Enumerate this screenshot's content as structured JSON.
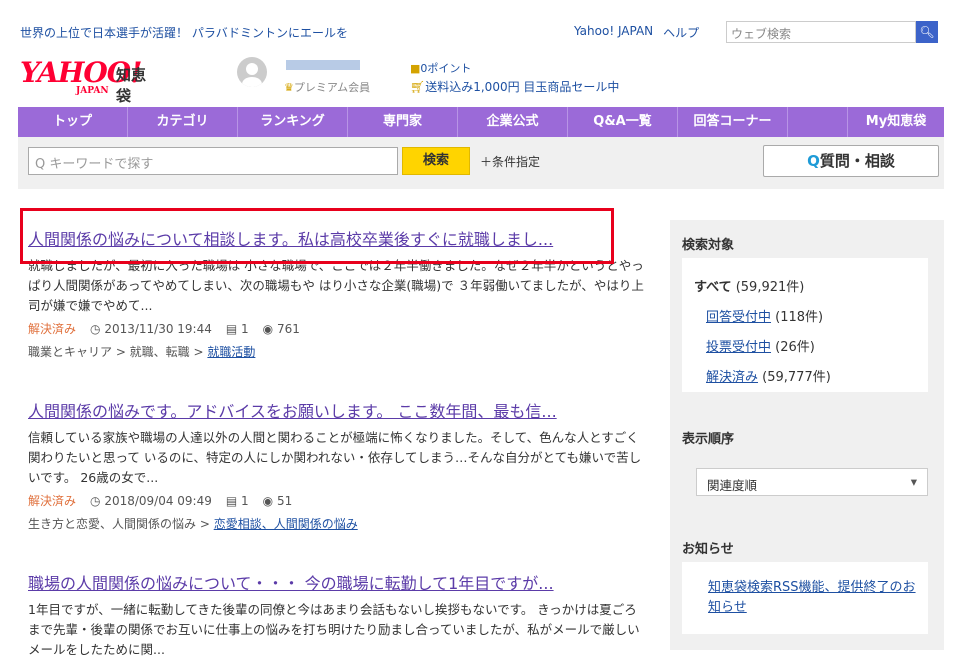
{
  "header": {
    "promo": "世界の上位で日本選手が活躍！ パラバドミントンにエールを",
    "links": [
      "Yahoo! JAPAN",
      "ヘルプ"
    ],
    "web_search_placeholder": "ウェブ検索",
    "logo_text": "YAHOO!",
    "logo_sub": "JAPAN",
    "logo_service": "知恵袋",
    "premium": "プレミアム会員",
    "points": "0ポイント",
    "sale": "送料込み1,000円 目玉商品セール中"
  },
  "nav": {
    "items": [
      "トップ",
      "カテゴリ",
      "ランキング",
      "専門家",
      "企業公式",
      "Q&A一覧",
      "回答コーナー",
      "",
      "My知恵袋"
    ]
  },
  "search": {
    "placeholder": "キーワードで探す",
    "button": "検索",
    "conditions": "条件指定",
    "ask_button": "質問・相談"
  },
  "results": [
    {
      "title": "人間関係の悩みについて相談します。私は高校卒業後すぐに就職しまし...",
      "body": "就職しましたが、最初に入った職場は 小さな職場で、ここでは２年半働きました。なぜ２年半かというとやっぱり人間関係があってやめてしまい、次の職場もや はり小さな企業(職場)で ３年弱働いてましたが、やはり上司が嫌で嫌でやめて...",
      "status": "解決済み",
      "date": "2013/11/30 19:44",
      "answers": "1",
      "views": "761",
      "category_path": "職業とキャリア > 就職、転職 > ",
      "category_link": "就職活動"
    },
    {
      "title": "人間関係の悩みです。アドバイスをお願いします。 ここ数年間、最も信...",
      "body": "信頼している家族や職場の人達以外の人間と関わることが極端に怖くなりました。そして、色んな人とすごく関わりたいと思って いるのに、特定の人にしか関われない・依存してしまう…そんな自分がとても嫌いで苦しいです。 26歳の女で...",
      "status": "解決済み",
      "date": "2018/09/04 09:49",
      "answers": "1",
      "views": "51",
      "category_path": "生き方と恋愛、人間関係の悩み > ",
      "category_link": "恋愛相談、人間関係の悩み"
    },
    {
      "title": "職場の人間関係の悩みについて・・・ 今の職場に転勤して1年目ですが...",
      "body": "1年目ですが、一緒に転勤してきた後輩の同僚と今はあまり会話もないし挨拶もないです。 きっかけは夏ごろまで先輩・後輩の関係でお互いに仕事上の悩みを打ち明けたり励まし合っていましたが、私がメールで厳しいメールをしたために関..."
    }
  ],
  "sidebar": {
    "target_heading": "検索対象",
    "all_label": "すべて",
    "all_count": "(59,921件)",
    "filters": [
      {
        "label": "回答受付中",
        "count": "(118件)"
      },
      {
        "label": "投票受付中",
        "count": "(26件)"
      },
      {
        "label": "解決済み",
        "count": "(59,777件)"
      }
    ],
    "order_heading": "表示順序",
    "order_value": "関連度順",
    "notice_heading": "お知らせ",
    "notice_link": "知恵袋検索RSS機能、提供終了のお知らせ"
  }
}
